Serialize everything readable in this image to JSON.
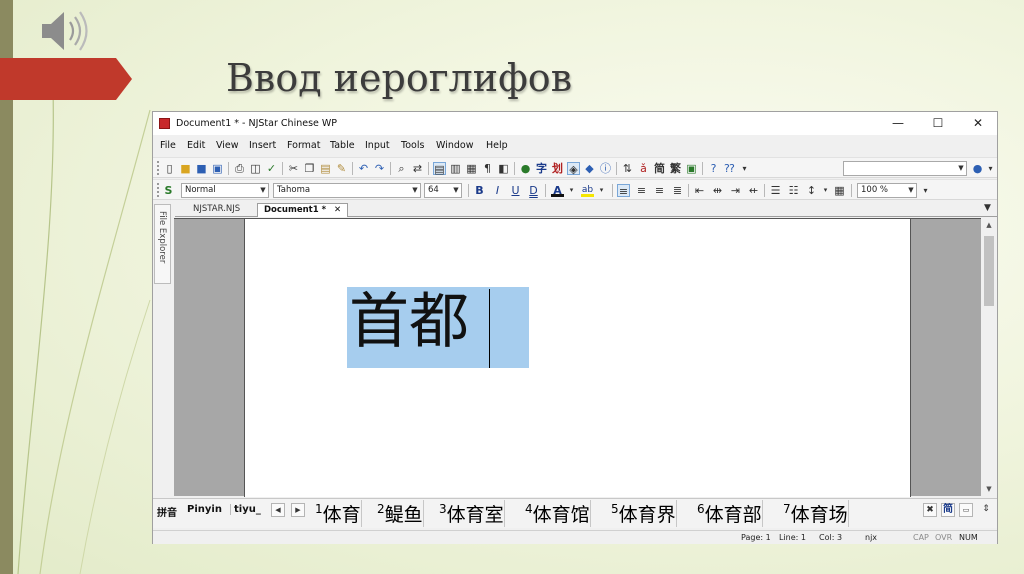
{
  "slide": {
    "title": "Ввод иероглифов",
    "colors": {
      "accent_red": "#c0392b",
      "left_bar": "#8b8a60",
      "title_text": "#3c3c3c"
    }
  },
  "window": {
    "title": "Document1 * - NJStar Chinese WP",
    "controls": {
      "minimize": "—",
      "maximize": "☐",
      "close": "✕"
    }
  },
  "menu": [
    "File",
    "Edit",
    "View",
    "Insert",
    "Format",
    "Table",
    "Input",
    "Tools",
    "Window",
    "Help"
  ],
  "format_toolbar": {
    "style_value": "Normal",
    "font_value": "Tahoma",
    "size_value": "64",
    "zoom_value": "100 %",
    "bold": "B",
    "italic": "I",
    "underline": "U",
    "double_underline": "D",
    "font_color": "A",
    "highlight": "ab",
    "toolbar_chars": {
      "zi": "字",
      "hua": "划",
      "jian": "简",
      "fan": "繁"
    }
  },
  "tabs": {
    "items": [
      "NJSTAR.NJS",
      "Document1 *"
    ],
    "active": "Document1 *",
    "close": "✕"
  },
  "file_explorer_label": "File Explorer",
  "document": {
    "text": "首都"
  },
  "ime": {
    "label_cn": "拼音",
    "mode": "Pinyin",
    "input": "tiyu_",
    "candidates": [
      {
        "num": "1",
        "chars": "体育"
      },
      {
        "num": "2",
        "chars": "鳀鱼"
      },
      {
        "num": "3",
        "chars": "体育室"
      },
      {
        "num": "4",
        "chars": "体育馆"
      },
      {
        "num": "5",
        "chars": "体育界"
      },
      {
        "num": "6",
        "chars": "体育部"
      },
      {
        "num": "7",
        "chars": "体育场"
      }
    ],
    "right_buttons": {
      "close": "✖",
      "jian": "简"
    }
  },
  "status": {
    "page": "Page: 1",
    "line": "Line: 1",
    "col": "Col: 3",
    "ext": "njx",
    "cap": "CAP",
    "ovr": "OVR",
    "num": "NUM"
  }
}
